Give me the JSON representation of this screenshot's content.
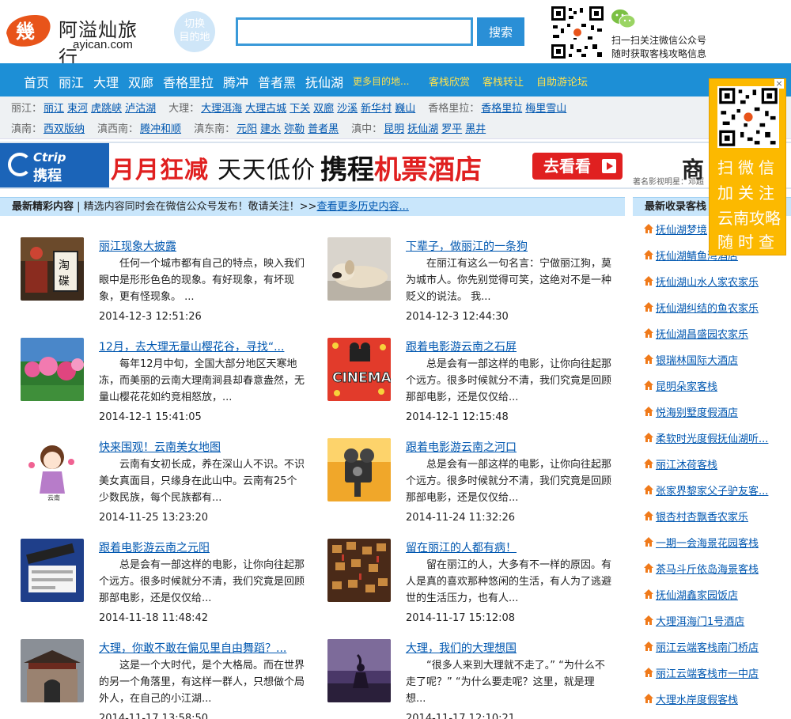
{
  "header": {
    "logo_name": "阿溢灿旅行",
    "logo_domain": "ayican.com",
    "switch_label_1": "切换",
    "switch_label_2": "目的地",
    "search_value": "",
    "search_button": "搜索",
    "wechat_line_1": "扫一扫关注微信公众号",
    "wechat_line_2": "随时获取客栈攻略信息"
  },
  "nav": {
    "items": [
      "首页",
      "丽江",
      "大理",
      "双廊",
      "香格里拉",
      "腾冲",
      "普者黑",
      "抚仙湖"
    ],
    "more": "更多目的地...",
    "extra": [
      "客栈欣赏",
      "客栈转让",
      "自助游论坛"
    ]
  },
  "subnav": {
    "row1": [
      {
        "label": "丽江：",
        "links": [
          "丽江",
          "束河",
          "虎跳峡",
          "泸沽湖"
        ]
      },
      {
        "label": "大理：",
        "links": [
          "大理洱海",
          "大理古城",
          "下关",
          "双廊",
          "沙溪",
          "新华村",
          "巍山"
        ]
      },
      {
        "label": "香格里拉：",
        "links": [
          "香格里拉",
          "梅里雪山"
        ]
      }
    ],
    "row2": [
      {
        "label": "滇南：",
        "links": [
          "西双版纳"
        ]
      },
      {
        "label": "滇西南：",
        "links": [
          "腾冲和顺"
        ]
      },
      {
        "label": "滇东南：",
        "links": [
          "元阳",
          "建水",
          "弥勒",
          "普者黑"
        ]
      },
      {
        "label": "滇中：",
        "links": [
          "昆明",
          "抚仙湖",
          "罗平",
          "黑井"
        ]
      }
    ]
  },
  "banner": {
    "ctrip_en": "Ctrip",
    "ctrip_cn": "携程",
    "slogan_red": "月月狂减",
    "slogan_black": "天天低价",
    "brand": "携程",
    "brand_red": "机票酒店",
    "cta": "去看看",
    "note": "著名影视明星：邓超",
    "extra": "商"
  },
  "latest": {
    "title": "最新精彩内容",
    "note": "| 精选内容同时会在微信公众号发布！敬请关注！>>",
    "more": "查看更多历史内容..."
  },
  "articles": [
    {
      "title": "丽江现象大披露",
      "summary": "任何一个城市都有自己的特点，映入我们眼中是形形色色的现象。有好现象，有坏现象，更有怪现象。        ...",
      "date": "2014-12-3 12:51:26",
      "thumb": "hotel-sign"
    },
    {
      "title": "下辈子，做丽江的一条狗",
      "summary": "在丽江有这么一句名言：宁做丽江狗，莫为城市人。你先别觉得可笑，这绝对不是一种贬义的说法。       我...",
      "date": "2014-12-3 12:44:30",
      "thumb": "dog"
    },
    {
      "title": "12月，去大理无量山樱花谷，寻找“...",
      "summary": "每年12月中旬，全国大部分地区天寒地冻，而美丽的云南大理南涧县却春意盎然，无量山樱花花如约竞相怒放，...",
      "date": "2014-12-1 15:41:05",
      "thumb": "flowers"
    },
    {
      "title": "跟着电影游云南之石屏",
      "summary": "总是会有一部这样的电影，让你向往起那个远方。很多时候就分不清，我们究竟是回顾那部电影，还是仅仅给...",
      "date": "2014-12-1 12:15:48",
      "thumb": "cinema"
    },
    {
      "title": "快来围观！云南美女地图",
      "summary": "云南有女初长成，养在深山人不识。不识美女真面目，只缘身在此山中。云南有25个少数民族，每个民族都有...",
      "date": "2014-11-25 13:23:20",
      "thumb": "cartoon-girl"
    },
    {
      "title": "跟着电影游云南之河口",
      "summary": "总是会有一部这样的电影，让你向往起那个远方。很多时候就分不清，我们究竟是回顾那部电影，还是仅仅给...",
      "date": "2014-11-24 11:32:26",
      "thumb": "projector"
    },
    {
      "title": "跟着电影游云南之元阳",
      "summary": "总是会有一部这样的电影，让你向往起那个远方。很多时候就分不清，我们究竟是回顾那部电影，还是仅仅给...",
      "date": "2014-11-18 11:48:42",
      "thumb": "clapperboard"
    },
    {
      "title": "留在丽江的人都有病！",
      "summary": "留在丽江的人，大多有不一样的原因。有人是真的喜欢那种悠闲的生活，有人为了逃避世的生活压力，也有人...",
      "date": "2014-11-17 15:12:08",
      "thumb": "wish-cards"
    },
    {
      "title": "大理，你敢不敢在偏见里自由舞蹈？...",
      "summary": "这是一个大时代，是个大格局。而在世界的另一个角落里，有这样一群人，只想做个局外人，在自己的小江湖...",
      "date": "2014-11-17 13:58:50",
      "thumb": "old-gate"
    },
    {
      "title": "大理，我们的大理想国",
      "summary": "“很多人来到大理就不走了。”   “为什么不走了呢？”          “为什么要走呢？这里，就是理想...",
      "date": "2014-11-17 12:10:21",
      "thumb": "silhouette"
    }
  ],
  "new_inns": {
    "title": "最新收录客栈",
    "items": [
      "抚仙湖梦境",
      "抚仙湖鲭鱼湾酒店",
      "抚仙湖山水人家农家乐",
      "抚仙湖纠结的鱼农家乐",
      "抚仙湖昌盛园农家乐",
      "银瑞林国际大酒店",
      "昆明朵家客栈",
      "悦海别墅度假酒店",
      "柔软时光度假抚仙湖听...",
      "丽江沐荷客栈",
      "张家界黎家父子驴友客...",
      "银杏村杏飘香农家乐",
      "一期一会海景花园客栈",
      "茶马斗斤依岛海景客栈",
      "抚仙湖鑫家园饭店",
      "大理洱海门1号酒店",
      "丽江云端客栈南门桥店",
      "丽江云端客栈市一中店",
      "大理水岸度假客栈"
    ]
  },
  "float_qr": {
    "lines": [
      "扫微信",
      "加关注",
      "云南攻略",
      "随时查"
    ],
    "close": "×"
  },
  "colors": {
    "nav_bg": "#1d8fd6",
    "link": "#0057b0",
    "section_bar": "#c9e6fb",
    "float_bg": "#fcb900",
    "accent_yellow": "#ffe14d",
    "banner_red": "#e02020"
  }
}
